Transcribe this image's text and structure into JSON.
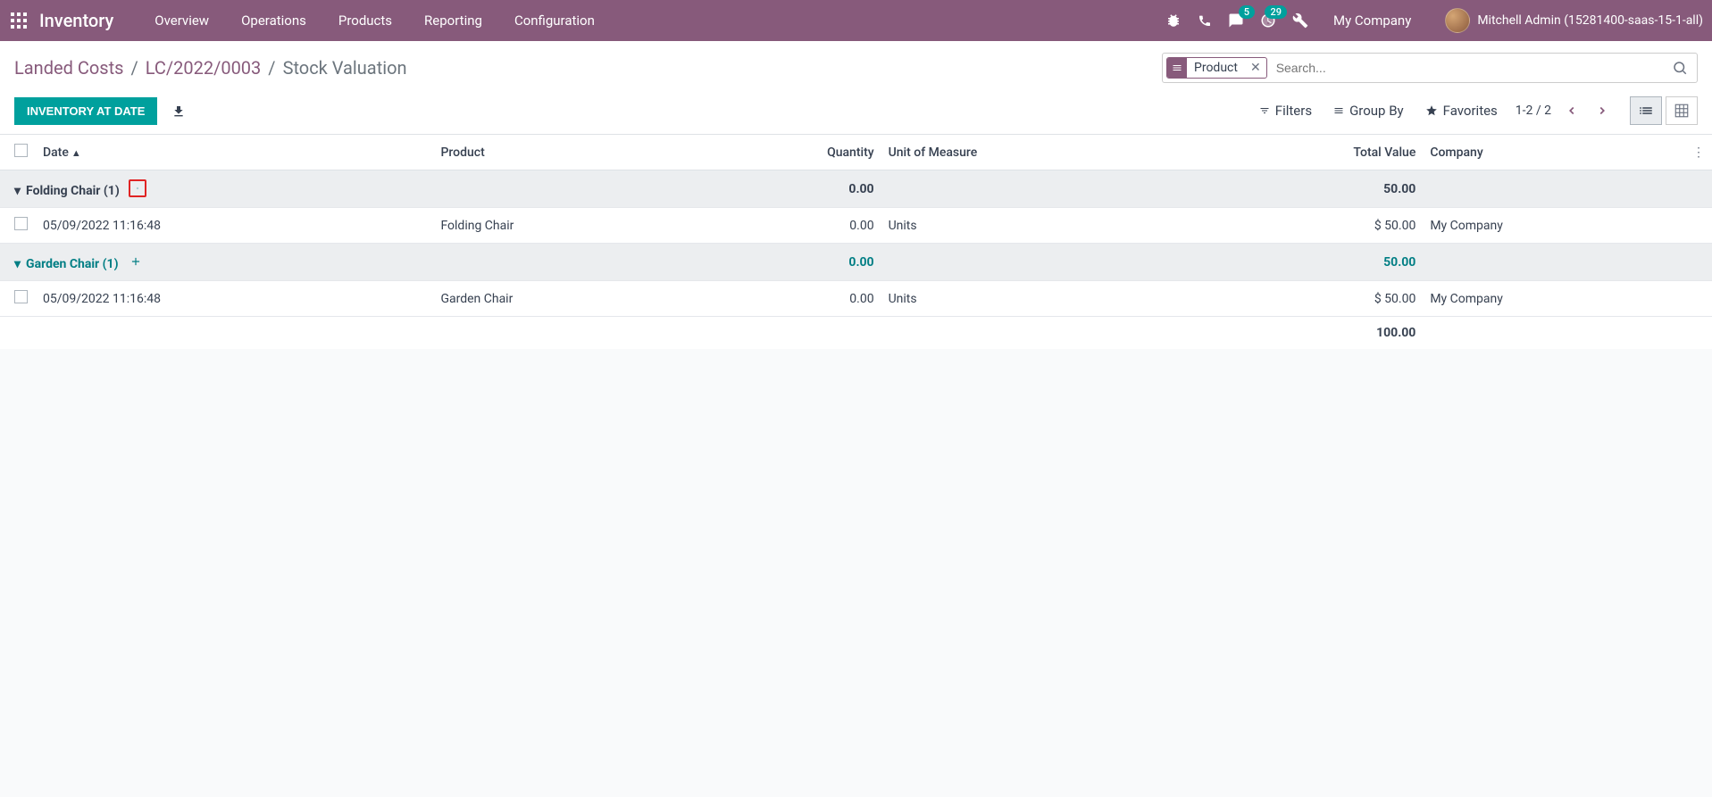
{
  "topbar": {
    "brand": "Inventory",
    "nav": [
      "Overview",
      "Operations",
      "Products",
      "Reporting",
      "Configuration"
    ],
    "messages_badge": "5",
    "activities_badge": "29",
    "company": "My Company",
    "user": "Mitchell Admin (15281400-saas-15-1-all)"
  },
  "breadcrumb": {
    "items": [
      "Landed Costs",
      "LC/2022/0003"
    ],
    "current": "Stock Valuation"
  },
  "search": {
    "facet_label": "Product",
    "placeholder": "Search..."
  },
  "buttons": {
    "inventory_at_date": "INVENTORY AT DATE"
  },
  "search_options": {
    "filters": "Filters",
    "group_by": "Group By",
    "favorites": "Favorites"
  },
  "pager": {
    "range": "1-2 / 2"
  },
  "columns": {
    "date": "Date",
    "product": "Product",
    "quantity": "Quantity",
    "uom": "Unit of Measure",
    "total_value": "Total Value",
    "company": "Company"
  },
  "groups": [
    {
      "title": "Folding Chair (1)",
      "highlighted": true,
      "quantity": "0.00",
      "total_value": "50.00",
      "rows": [
        {
          "date": "05/09/2022 11:16:48",
          "product": "Folding Chair",
          "quantity": "0.00",
          "uom": "Units",
          "total_value": "$ 50.00",
          "company": "My Company"
        }
      ]
    },
    {
      "title": "Garden Chair (1)",
      "highlighted": false,
      "quantity": "0.00",
      "total_value": "50.00",
      "rows": [
        {
          "date": "05/09/2022 11:16:48",
          "product": "Garden Chair",
          "quantity": "0.00",
          "uom": "Units",
          "total_value": "$ 50.00",
          "company": "My Company"
        }
      ]
    }
  ],
  "footer": {
    "grand_total": "100.00"
  }
}
